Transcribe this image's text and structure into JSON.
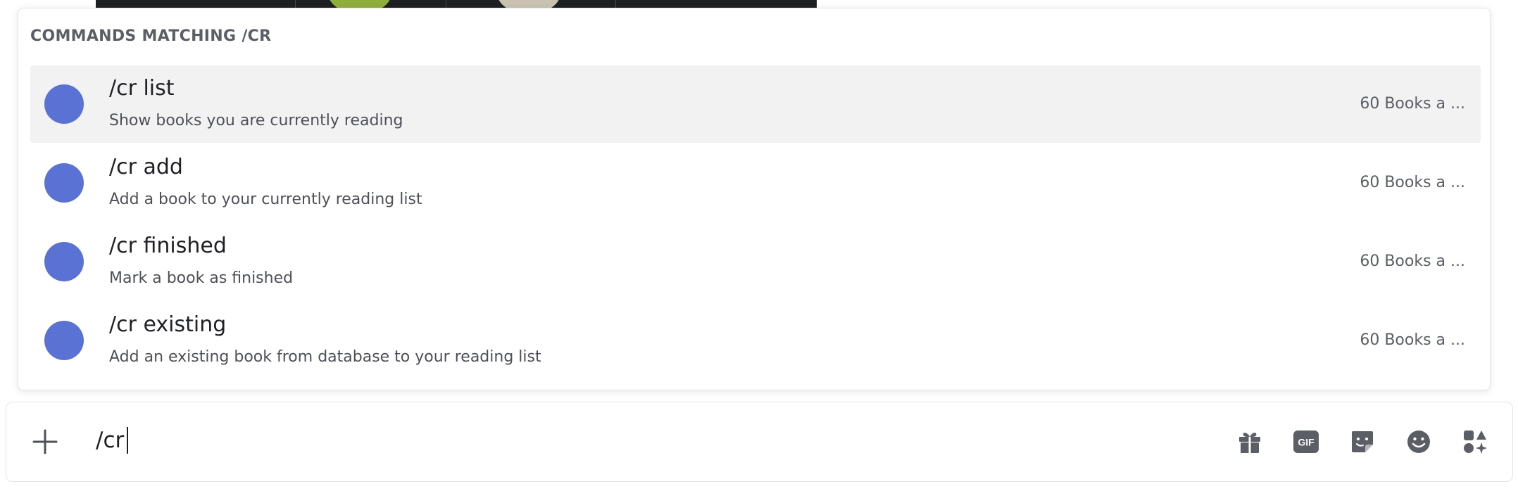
{
  "autocomplete": {
    "header": "COMMANDS MATCHING /CR",
    "commands": [
      {
        "name": "/cr list",
        "description": "Show books you are currently reading",
        "source": "60 Books a ...",
        "icon": "app-avatar-icon",
        "selected": true
      },
      {
        "name": "/cr add",
        "description": "Add a book to your currently reading list",
        "source": "60 Books a ...",
        "icon": "app-avatar-icon",
        "selected": false
      },
      {
        "name": "/cr finished",
        "description": "Mark a book as finished",
        "source": "60 Books a ...",
        "icon": "app-avatar-icon",
        "selected": false
      },
      {
        "name": "/cr existing",
        "description": "Add an existing book from database to your reading list",
        "source": "60 Books a ...",
        "icon": "app-avatar-icon",
        "selected": false
      }
    ]
  },
  "composer": {
    "value": "/cr",
    "buttons": [
      {
        "icon": "plus-icon",
        "action": "attach"
      },
      {
        "icon": "gift-icon",
        "action": "gift"
      },
      {
        "icon": "gif-icon",
        "action": "gif",
        "text": "GIF"
      },
      {
        "icon": "sticker-icon",
        "action": "sticker"
      },
      {
        "icon": "emoji-icon",
        "action": "emoji"
      },
      {
        "icon": "apps-icon",
        "action": "apps"
      }
    ]
  },
  "colors": {
    "accent_avatar": "#5b72d5",
    "selected_row": "#f2f2f3",
    "icon_gray": "#5c5e66",
    "text_primary": "#1f2024",
    "text_secondary": "#4e5058"
  }
}
